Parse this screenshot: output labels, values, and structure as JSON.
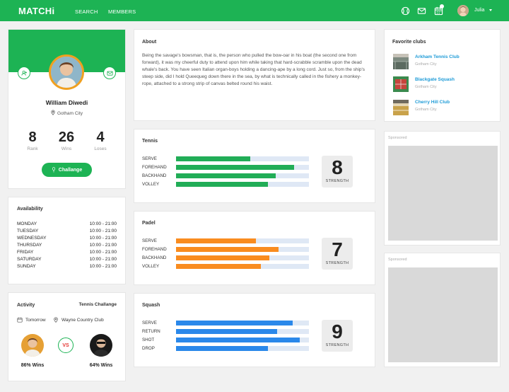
{
  "topbar": {
    "logo": "MATCHi",
    "nav": [
      "SEARCH",
      "MEMBERS"
    ],
    "user_name": "Julia",
    "icons": [
      "tennis-ball-icon",
      "mail-icon",
      "calendar-icon"
    ],
    "accent": "#1db354"
  },
  "profile": {
    "name": "William Diwedi",
    "city": "Gotham City",
    "stats": [
      {
        "value": "8",
        "label": "Rank"
      },
      {
        "value": "26",
        "label": "Wins"
      },
      {
        "value": "4",
        "label": "Loses"
      }
    ],
    "challenge_label": "Challange"
  },
  "availability": {
    "title": "Availability",
    "days": [
      {
        "day": "MONDAY",
        "time": "10:00 - 21:00"
      },
      {
        "day": "TUESDAY",
        "time": "10:00 - 21:00"
      },
      {
        "day": "WEDNESDAY",
        "time": "10:00 - 21:00"
      },
      {
        "day": "THURSDAY",
        "time": "10:00 - 21:00"
      },
      {
        "day": "FRIDAY",
        "time": "10:00 - 21:00"
      },
      {
        "day": "SATURDAY",
        "time": "10:00 - 21:00"
      },
      {
        "day": "SUNDAY",
        "time": "10:00 - 21:00"
      }
    ]
  },
  "activity": {
    "title": "Activity",
    "type": "Tennis Challange",
    "when": "Tomorrow",
    "where": "Wayne Country Club",
    "vs": "VS",
    "player1_wins": "86% Wins",
    "player2_wins": "64% Wins"
  },
  "about": {
    "title": "About",
    "text": "Being the savage's bowsman, that is, the person who pulled the bow-oar in his boat (the second one from forward), it was my cheerful duty to attend upon him while taking that hard-scrabble scramble upon the dead whale's back. You have seen Italian organ-boys holding a dancing-ape by a long cord. Just so, from the ship's steep side, did I hold Queequeg down there in the sea, by what is technically called in the fishery a monkey-rope, attached to a strong strip of canvas belted round his waist."
  },
  "sports": [
    {
      "title": "Tennis",
      "color": "#21ad57",
      "strength": "8",
      "strength_label": "STRENGTH",
      "skills": [
        {
          "label": "SERVE",
          "level": 0.56
        },
        {
          "label": "FOREHAND",
          "level": 0.89
        },
        {
          "label": "BACKHAND",
          "level": 0.75
        },
        {
          "label": "VOLLEY",
          "level": 0.69
        }
      ]
    },
    {
      "title": "Padel",
      "color": "#f98c1f",
      "strength": "7",
      "strength_label": "STRENGTH",
      "skills": [
        {
          "label": "SERVE",
          "level": 0.6
        },
        {
          "label": "FOREHAND",
          "level": 0.77
        },
        {
          "label": "BACKHAND",
          "level": 0.7
        },
        {
          "label": "VOLLEY",
          "level": 0.64
        }
      ]
    },
    {
      "title": "Squash",
      "color": "#2a88ea",
      "strength": "9",
      "strength_label": "STRENGTH",
      "skills": [
        {
          "label": "SERVE",
          "level": 0.88
        },
        {
          "label": "RETURN",
          "level": 0.76
        },
        {
          "label": "SHOT",
          "level": 0.93
        },
        {
          "label": "DROP",
          "level": 0.69
        }
      ]
    }
  ],
  "clubs": {
    "title": "Favorite clubs",
    "items": [
      {
        "name": "Arkham Tennis Club",
        "city": "Gotham City"
      },
      {
        "name": "Blackgate Squash",
        "city": "Gotham City"
      },
      {
        "name": "Cherry Hill Club",
        "city": "Gotham City"
      }
    ]
  },
  "sponsored": [
    "Sponsored",
    "Sponsored"
  ]
}
